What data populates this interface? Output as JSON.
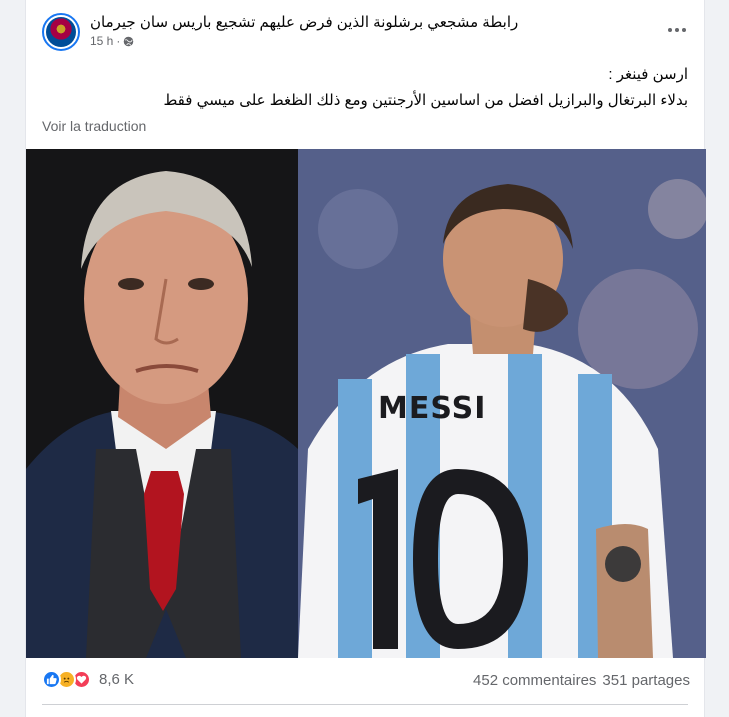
{
  "post": {
    "page_name": "رابطة مشجعي برشلونة الذين فرض عليهم تشجيع باريس سان جيرمان",
    "time": "15 h",
    "text_line1": "ارسن فينغر :",
    "text_line2": "بدلاء البرتغال والبرازيل افضل من اساسين الأرجنتين ومع ذلك الظغط على ميسي فقط",
    "translate_link": "Voir la traduction",
    "image_alt": "Arsène Wenger and Lionel Messi side by side"
  },
  "stats": {
    "reaction_icons": [
      "like-icon",
      "sad-icon",
      "love-icon"
    ],
    "reaction_count": "8,6 K",
    "comments": "452 commentaires",
    "shares": "351 partages"
  },
  "colors": {
    "accent": "#1877f2",
    "muted_text": "#65676b",
    "love": "#f33e58",
    "sad": "#f7b125"
  }
}
